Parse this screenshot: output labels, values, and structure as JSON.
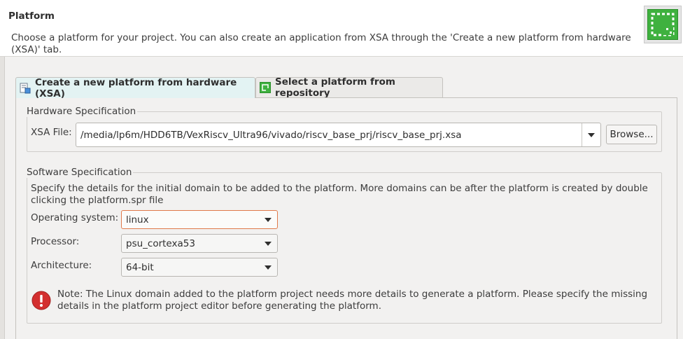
{
  "header": {
    "title": "Platform",
    "description": "Choose a platform for your project. You can also create an application from XSA through the 'Create a new platform from hardware (XSA)' tab.",
    "logo_icon": "vitis-platform-logo-icon"
  },
  "tabs": [
    {
      "label": "Create a new platform from hardware (XSA)",
      "icon": "hardware-xsa-icon",
      "active": true
    },
    {
      "label": "Select a platform from repository",
      "icon": "platform-repository-icon",
      "active": false
    }
  ],
  "hardware_spec": {
    "group_label": "Hardware Specification",
    "xsa_label": "XSA File:",
    "xsa_value": "/media/lp6m/HDD6TB/VexRiscv_Ultra96/vivado/riscv_base_prj/riscv_base_prj.xsa",
    "browse_label": "Browse..."
  },
  "software_spec": {
    "group_label": "Software Specification",
    "description": "Specify the details for the initial domain to be added to the platform. More domains can be after the platform is created by double clicking the platform.spr file",
    "os_label": "Operating system:",
    "os_value": "linux",
    "processor_label": "Processor:",
    "processor_value": "psu_cortexa53",
    "arch_label": "Architecture:",
    "arch_value": "64-bit",
    "note_icon": "error-icon",
    "note": "Note: The Linux domain added to the platform project needs more details to generate a platform. Please specify the missing details in the platform project editor before generating the platform."
  },
  "colors": {
    "focus_border": "#e0794a",
    "error_red": "#d32f2f",
    "logo_green": "#3fb13f",
    "active_tab": "#e3f3f3"
  }
}
